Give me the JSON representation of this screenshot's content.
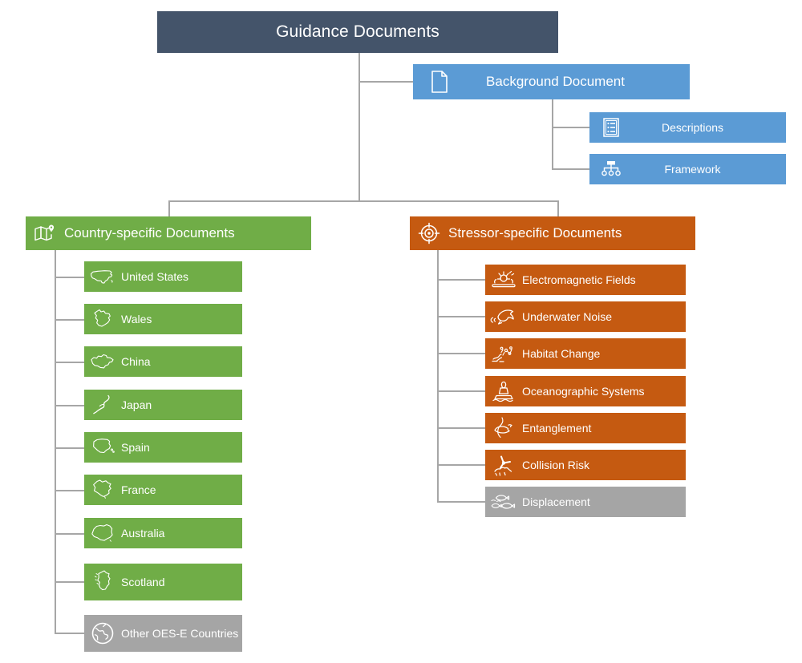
{
  "diagram": {
    "title": "Guidance Documents",
    "colors": {
      "root": "#44546A",
      "blue": "#5B9BD5",
      "green": "#70AD47",
      "orange": "#C55A11",
      "gray": "#A5A5A5",
      "connector": "#A6A6A6",
      "text": "#FFFFFF"
    }
  },
  "background": {
    "label": "Background Document",
    "icon": "document-icon",
    "children": [
      {
        "label": "Descriptions",
        "icon": "list-icon"
      },
      {
        "label": "Framework",
        "icon": "org-chart-icon"
      }
    ]
  },
  "country_branch": {
    "label": "Country-specific Documents",
    "icon": "map-pin-icon",
    "items": [
      {
        "label": "United States",
        "icon": "united-states-map-icon",
        "state": "active"
      },
      {
        "label": "Wales",
        "icon": "wales-map-icon",
        "state": "active"
      },
      {
        "label": "China",
        "icon": "china-map-icon",
        "state": "active"
      },
      {
        "label": "Japan",
        "icon": "japan-map-icon",
        "state": "active"
      },
      {
        "label": "Spain",
        "icon": "spain-map-icon",
        "state": "active"
      },
      {
        "label": "France",
        "icon": "france-map-icon",
        "state": "active"
      },
      {
        "label": "Australia",
        "icon": "australia-map-icon",
        "state": "active"
      },
      {
        "label": "Scotland",
        "icon": "scotland-map-icon",
        "state": "active"
      },
      {
        "label": "Other OES-E Countries",
        "icon": "globe-icon",
        "state": "inactive"
      }
    ]
  },
  "stressor_branch": {
    "label": "Stressor-specific Documents",
    "icon": "target-icon",
    "items": [
      {
        "label": "Electromagnetic Fields",
        "icon": "emf-cable-icon",
        "state": "active"
      },
      {
        "label": "Underwater Noise",
        "icon": "dolphin-sound-icon",
        "state": "active"
      },
      {
        "label": "Habitat Change",
        "icon": "seabed-debris-icon",
        "state": "active"
      },
      {
        "label": "Oceanographic Systems",
        "icon": "buoy-icon",
        "state": "active"
      },
      {
        "label": "Entanglement",
        "icon": "entangled-whale-icon",
        "state": "active"
      },
      {
        "label": "Collision Risk",
        "icon": "collision-turbine-icon",
        "state": "active"
      },
      {
        "label": "Displacement",
        "icon": "fish-school-icon",
        "state": "inactive"
      }
    ]
  }
}
